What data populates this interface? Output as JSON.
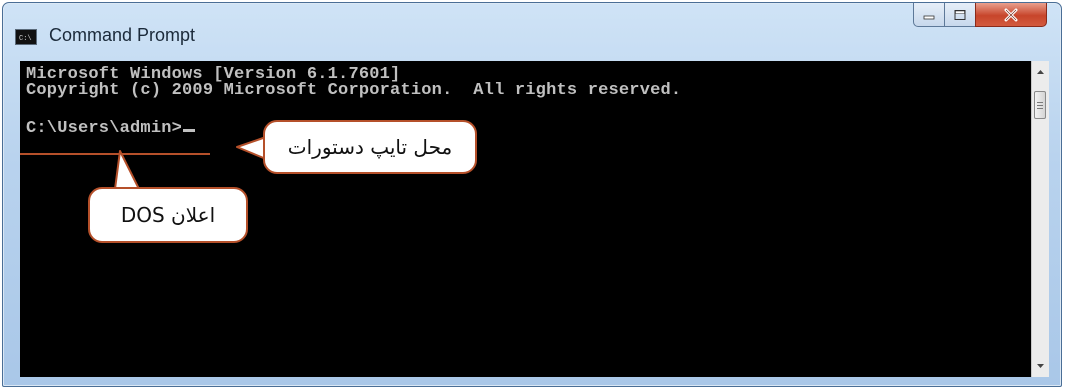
{
  "window": {
    "title": "Command Prompt",
    "icon": "cmd-icon",
    "controls": [
      "minimize-icon",
      "maximize-icon",
      "close-icon"
    ]
  },
  "console": {
    "lines": [
      "Microsoft Windows [Version 6.1.7601]",
      "Copyright (c) 2009 Microsoft Corporation.  All rights reserved.",
      "C:\\Users\\admin>"
    ],
    "text_color": "#c0c0c0",
    "background": "#000000"
  },
  "annotations": {
    "command_area": "محل تایپ دستورات",
    "dos_prompt": "اعلان DOS",
    "accent_color": "#b5502a"
  }
}
